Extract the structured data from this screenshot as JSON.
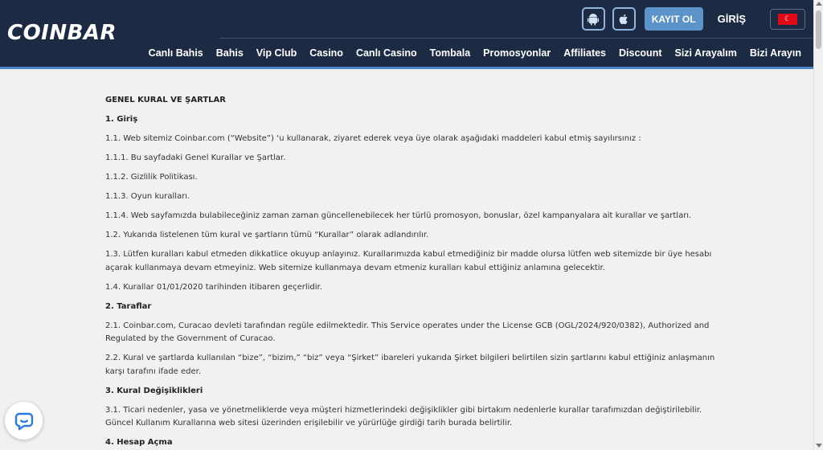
{
  "header": {
    "logo_text": "COINBAR",
    "register_label": "KAYIT OL",
    "login_label": "GİRİŞ",
    "language_flag": "turkey-flag-icon",
    "app_buttons": [
      "android-icon",
      "apple-icon"
    ]
  },
  "nav": [
    "Canlı Bahis",
    "Bahis",
    "Vip Club",
    "Casino",
    "Canlı Casino",
    "Tombala",
    "Promosyonlar",
    "Affiliates",
    "Discount",
    "Sizi Arayalım",
    "Bizi Arayın"
  ],
  "doc": {
    "title": "GENEL KURAL VE ŞARTLAR",
    "paragraphs": [
      {
        "type": "heading",
        "text": "1. Giriş"
      },
      {
        "type": "text",
        "text": "1.1. Web sitemiz Coinbar.com (“Website”) ‘u kullanarak, ziyaret ederek veya üye olarak aşağıdaki maddeleri kabul etmiş sayılırsınız :"
      },
      {
        "type": "text",
        "text": "1.1.1. Bu sayfadaki Genel Kurallar ve Şartlar."
      },
      {
        "type": "text",
        "text": "1.1.2. Gizlilik Politikası."
      },
      {
        "type": "text",
        "text": "1.1.3. Oyun kuralları."
      },
      {
        "type": "text",
        "text": "1.1.4. Web sayfamızda bulabileceğiniz zaman zaman güncellenebilecek her türlü promosyon, bonuslar, özel kampanyalara ait kurallar ve şartları."
      },
      {
        "type": "text",
        "text": "1.2. Yukarıda listelenen tüm kural ve şartların tümü “Kurallar” olarak adlandırılır."
      },
      {
        "type": "text",
        "text": "1.3. Lütfen kuralları kabul etmeden dikkatlice okuyup anlayınız. Kurallarımızda kabul etmediğiniz bir madde olursa lütfen web sitemizde bir üye hesabı açarak kullanmaya devam etmeyiniz. Web sitemize kullanmaya devam etmeniz kuralları kabul ettiğiniz anlamına gelecektir."
      },
      {
        "type": "text",
        "text": "1.4. Kurallar 01/01/2020 tarihinden itibaren geçerlidir."
      },
      {
        "type": "heading",
        "text": "2. Taraflar"
      },
      {
        "type": "text",
        "text": "2.1. Coinbar.com, Curacao devleti tarafından regüle edilmektedir. This Service operates under the License GCB (OGL/2024/920/0382), Authorized and Regulated by the Government of Curacao."
      },
      {
        "type": "text",
        "text": "2.2. Kural ve şartlarda kullanılan “bize”, “bizim,” “biz” veya “Şirket” ibareleri yukarıda Şirket bilgileri belirtilen sizin şartlarını kabul ettiğiniz anlaşmanın karşı tarafını ifade eder."
      },
      {
        "type": "heading",
        "text": "3. Kural Değişiklikleri"
      },
      {
        "type": "text",
        "text": "3.1. Ticari nedenler, yasa ve yönetmeliklerde veya müşteri hizmetlerindeki değişiklikler gibi birtakım nedenlerle kurallar tarafımızdan değiştirilebilir. Güncel Kullanım Kurallarına web sitesi üzerinden erişilebilir ve yürürlüğe girdiği tarih burada belirtilir."
      },
      {
        "type": "heading",
        "text": "4. Hesap Açma"
      }
    ]
  },
  "chat": {
    "icon": "chat-bubble-icon"
  }
}
